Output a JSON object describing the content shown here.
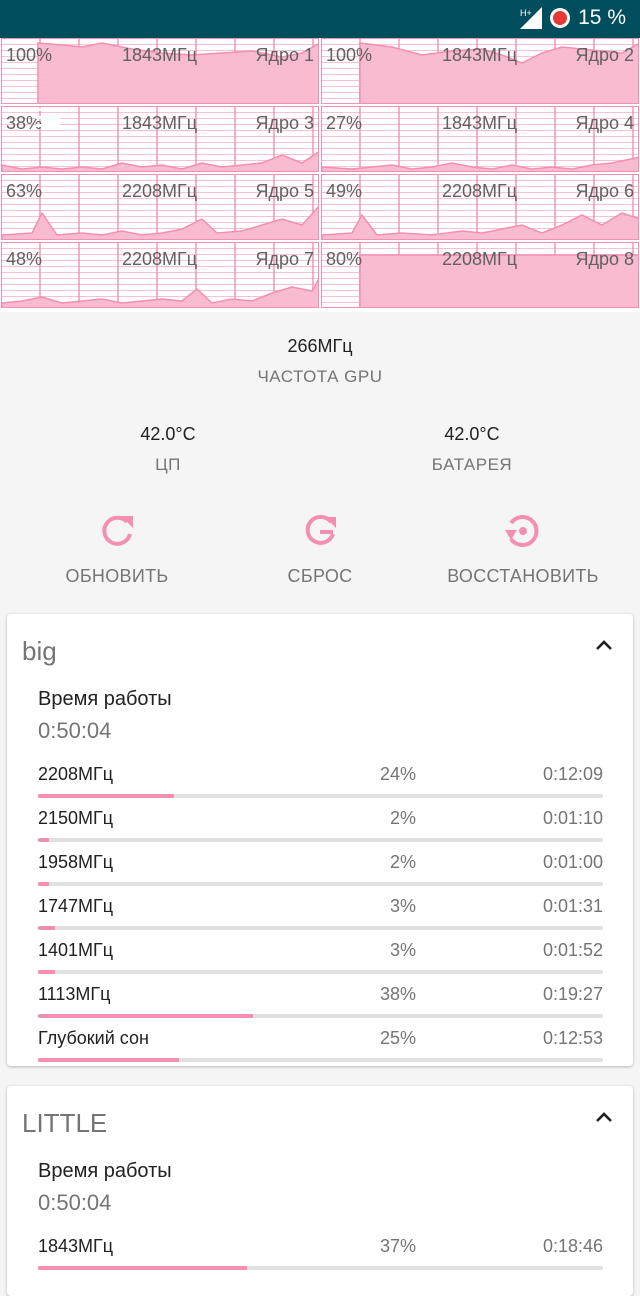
{
  "status_bar": {
    "network": "H+",
    "battery": "15 %"
  },
  "cores": [
    {
      "load": "100%",
      "freq": "1843МГц",
      "name": "Ядро 1",
      "level": 1.0,
      "fill_from": 0.11
    },
    {
      "load": "100%",
      "freq": "1843МГц",
      "name": "Ядро 2",
      "level": 1.0,
      "fill_from": 0.12
    },
    {
      "load": "38%",
      "freq": "1843МГц",
      "name": "Ядро 3",
      "level": 0.38,
      "fill_from": 0
    },
    {
      "load": "27%",
      "freq": "1843МГц",
      "name": "Ядро 4",
      "level": 0.27,
      "fill_from": 0
    },
    {
      "load": "63%",
      "freq": "2208МГц",
      "name": "Ядро 5",
      "level": 0.63,
      "fill_from": 0
    },
    {
      "load": "49%",
      "freq": "2208МГц",
      "name": "Ядро 6",
      "level": 0.49,
      "fill_from": 0
    },
    {
      "load": "48%",
      "freq": "2208МГц",
      "name": "Ядро 7",
      "level": 0.48,
      "fill_from": 0
    },
    {
      "load": "80%",
      "freq": "2208МГц",
      "name": "Ядро 8",
      "level": 0.8,
      "fill_from": 0.12
    }
  ],
  "gpu": {
    "value": "266МГц",
    "label": "ЧАСТОТА GPU"
  },
  "temps": [
    {
      "value": "42.0°C",
      "label": "ЦП"
    },
    {
      "value": "42.0°C",
      "label": "БАТАРЕЯ"
    }
  ],
  "actions": [
    {
      "label": "ОБНОВИТЬ",
      "icon": "refresh-icon"
    },
    {
      "label": "СБРОС",
      "icon": "reset-icon"
    },
    {
      "label": "ВОССТАНОВИТЬ",
      "icon": "restore-icon"
    }
  ],
  "clusters": [
    {
      "title": "big",
      "uptime_label": "Время работы",
      "uptime": "0:50:04",
      "states": [
        {
          "freq": "2208МГц",
          "percent": "24%",
          "time": "0:12:09",
          "fraction": 0.24
        },
        {
          "freq": "2150МГц",
          "percent": "2%",
          "time": "0:01:10",
          "fraction": 0.02
        },
        {
          "freq": "1958МГц",
          "percent": "2%",
          "time": "0:01:00",
          "fraction": 0.02
        },
        {
          "freq": "1747МГц",
          "percent": "3%",
          "time": "0:01:31",
          "fraction": 0.03
        },
        {
          "freq": "1401МГц",
          "percent": "3%",
          "time": "0:01:52",
          "fraction": 0.03
        },
        {
          "freq": "1113МГц",
          "percent": "38%",
          "time": "0:19:27",
          "fraction": 0.38
        },
        {
          "freq": "Глубокий сон",
          "percent": "25%",
          "time": "0:12:53",
          "fraction": 0.25
        }
      ]
    },
    {
      "title": "LITTLE",
      "uptime_label": "Время работы",
      "uptime": "0:50:04",
      "states": [
        {
          "freq": "1843МГц",
          "percent": "37%",
          "time": "0:18:46",
          "fraction": 0.37
        }
      ]
    }
  ],
  "colors": {
    "accent": "#f48fb1",
    "status_bar": "#004d5e",
    "graph_fill": "#f8bbd0"
  }
}
